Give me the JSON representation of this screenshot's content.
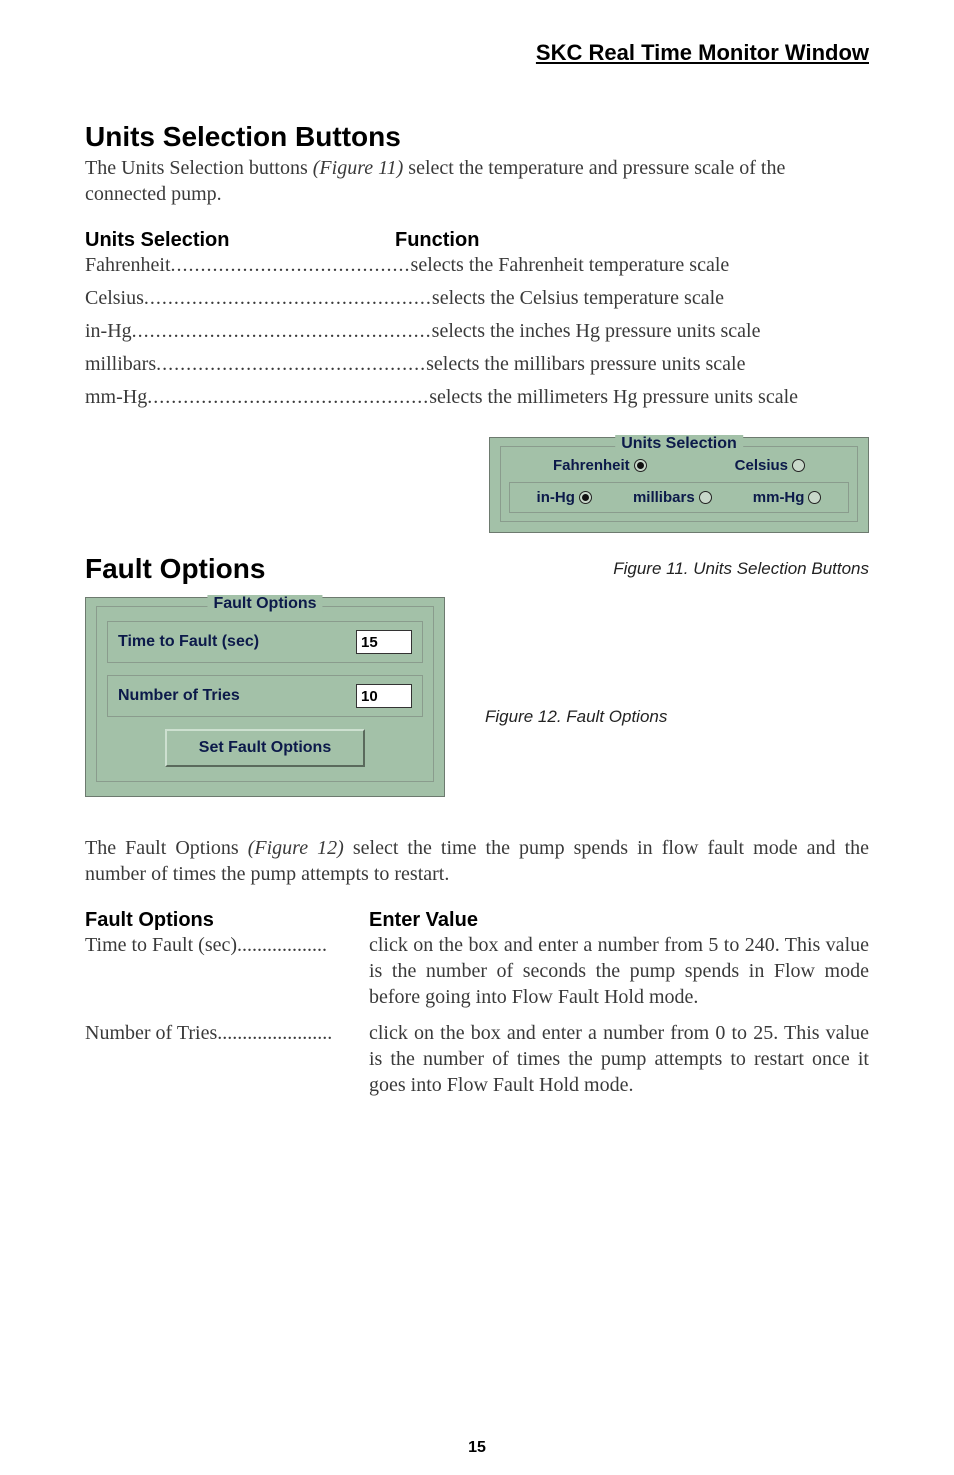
{
  "header": "SKC Real Time Monitor Window",
  "units_section": {
    "title": "Units Selection Buttons",
    "intro_a": "The Units Selection buttons ",
    "intro_fig": "(Figure 11)",
    "intro_b": " select the temperature and pressure scale of the connected pump.",
    "col_left": "Units Selection",
    "col_right": "Function",
    "rows": [
      {
        "term": "Fahrenheit ",
        "dots": "........................................",
        "desc": "selects the Fahrenheit temperature scale"
      },
      {
        "term": "Celsius",
        "dots": "................................................",
        "desc": "selects the Celsius temperature scale"
      },
      {
        "term": "in-Hg ",
        "dots": "..................................................",
        "desc": "selects the inches Hg pressure units scale"
      },
      {
        "term": "millibars",
        "dots": ".............................................",
        "desc": "selects the millibars pressure units scale"
      },
      {
        "term": "mm-Hg",
        "dots": "...............................................",
        "desc": "selects the millimeters Hg pressure units scale"
      }
    ]
  },
  "units_widget": {
    "legend": "Units Selection",
    "temp": {
      "fahrenheit": "Fahrenheit",
      "celsius": "Celsius"
    },
    "press": {
      "inhg": "in-Hg",
      "millibars": "millibars",
      "mmhg": "mm-Hg"
    }
  },
  "fig11": "Figure 11. Units Selection Buttons",
  "fault_section": {
    "title": "Fault Options"
  },
  "fault_widget": {
    "legend": "Fault Options",
    "time_label": "Time to Fault (sec)",
    "time_value": "15",
    "tries_label": "Number of Tries",
    "tries_value": "10",
    "button": "Set Fault Options"
  },
  "fig12": "Figure 12. Fault Options",
  "fault_intro_a": "The Fault Options ",
  "fault_intro_fig": "(Figure 12)",
  "fault_intro_b": " select the time the pump spends in flow fault mode and the number of times the pump attempts to restart.",
  "fault_table": {
    "col_left": "Fault Options",
    "col_right": "Enter Value",
    "rows": [
      {
        "termline": "Time to Fault (sec)..................",
        "desc": "click on the box and enter a number from 5 to 240. This value is the number of seconds the pump spends in Flow mode before going into Flow Fault Hold mode."
      },
      {
        "termline": "Number of Tries.......................",
        "desc": "click on the box and enter a number from 0 to 25. This value is the number of times the pump attempts to restart once it goes into Flow Fault Hold mode."
      }
    ]
  },
  "page": "15"
}
